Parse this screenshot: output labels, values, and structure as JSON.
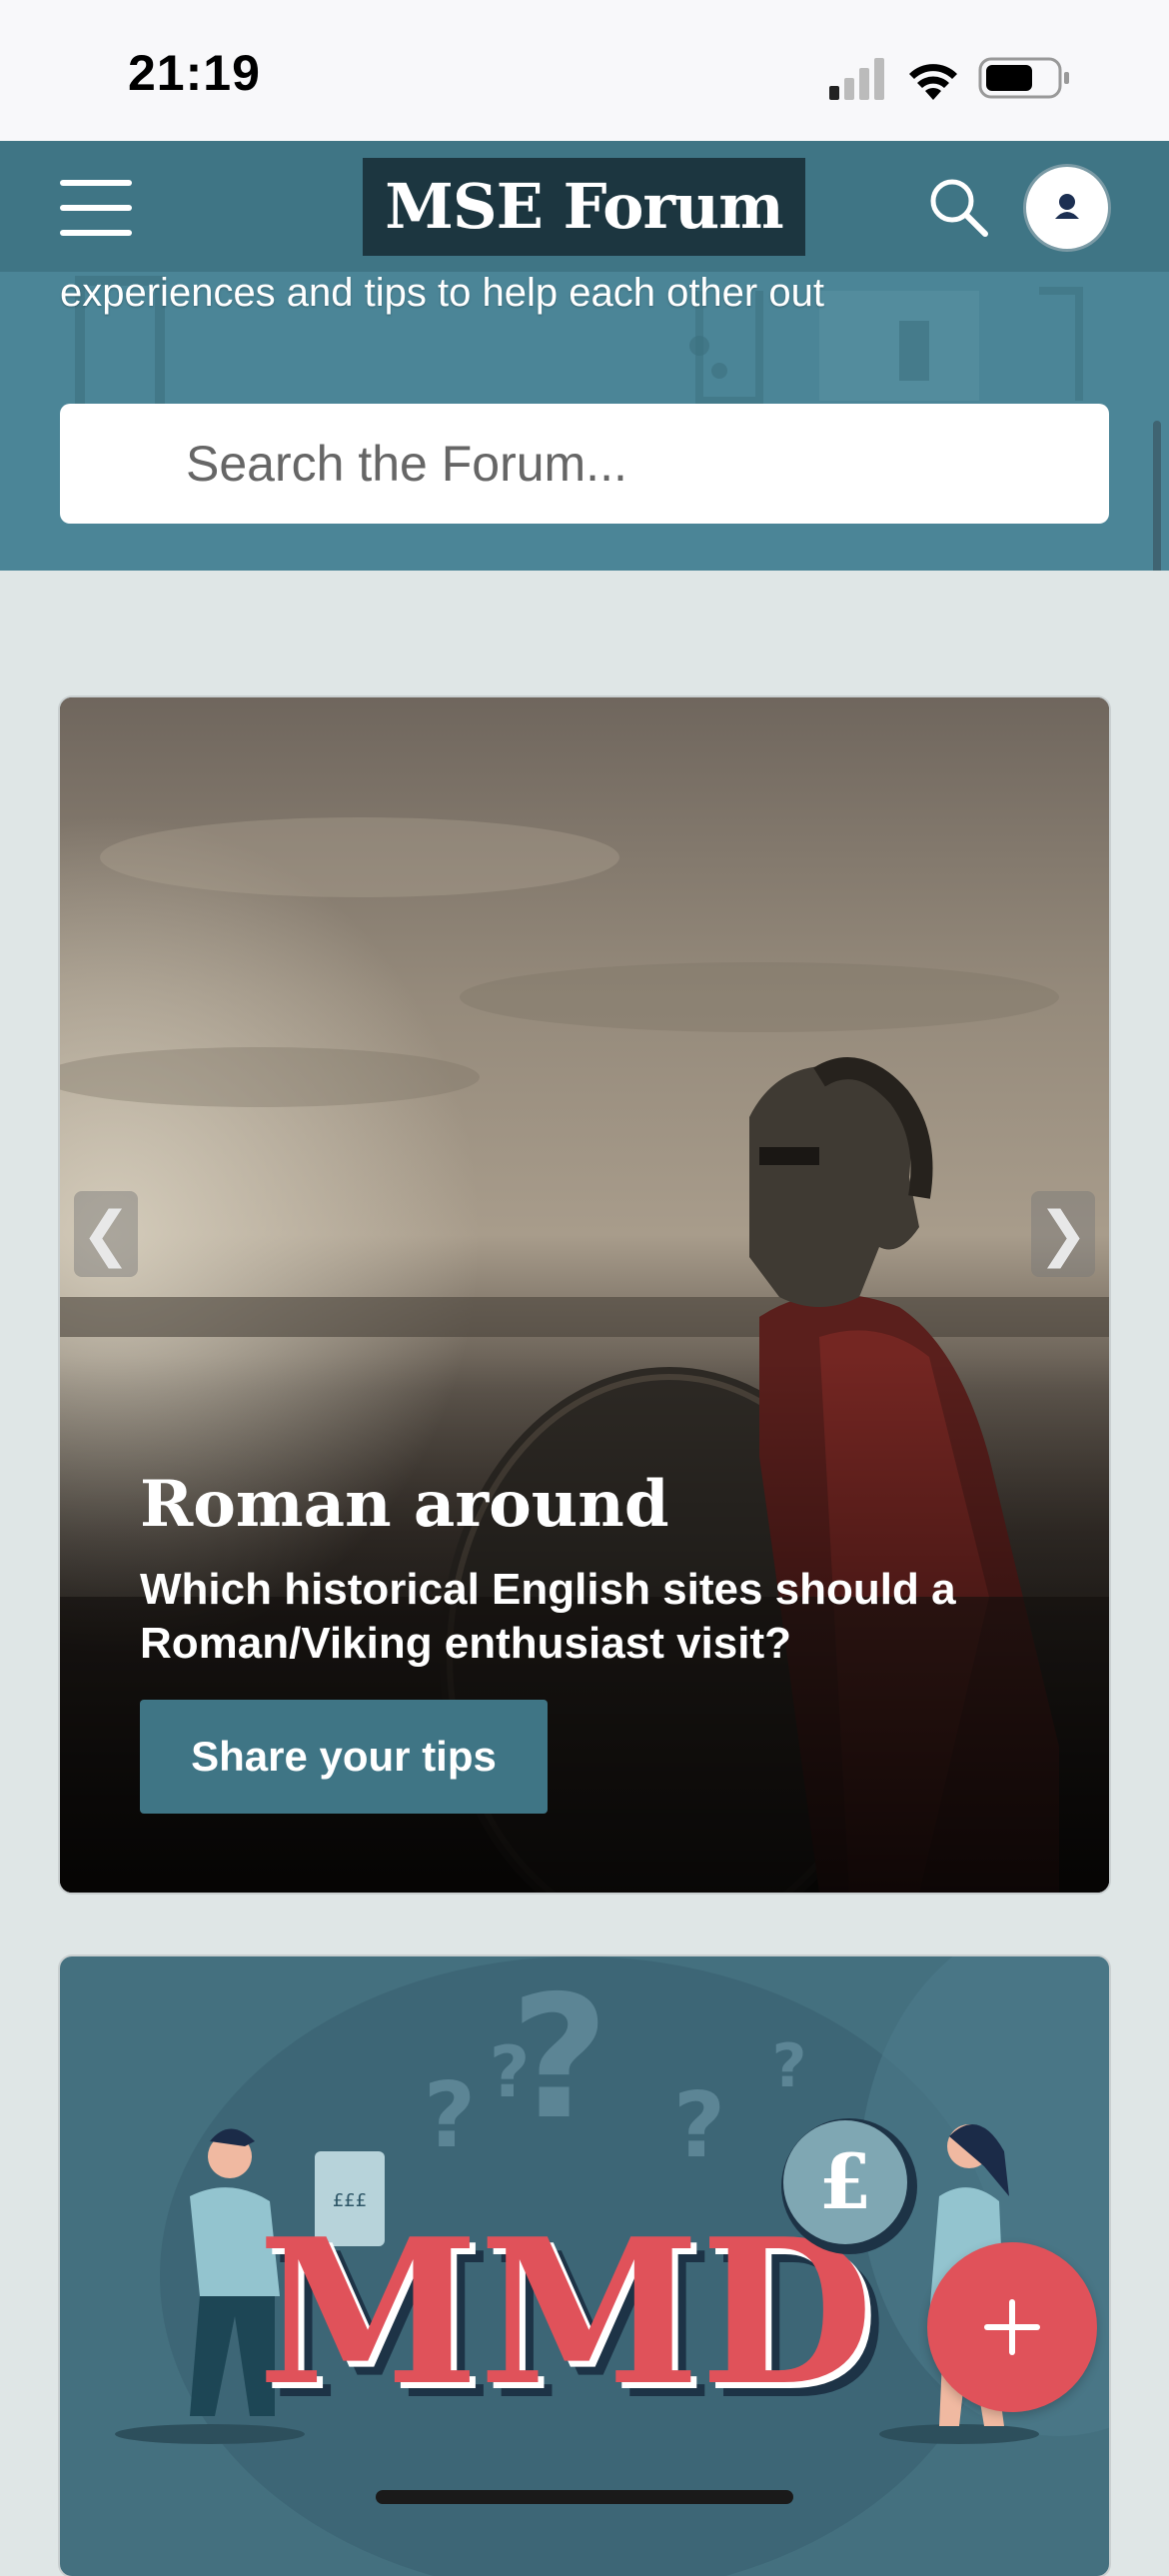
{
  "status_bar": {
    "time": "21:19",
    "icons": [
      "signal-icon",
      "wifi-icon",
      "battery-icon"
    ]
  },
  "header": {
    "logo": "MSE Forum",
    "menu_icon": "hamburger-menu-icon",
    "search_icon": "search-icon",
    "avatar_icon": "user-avatar-icon"
  },
  "hero": {
    "tagline": "experiences and tips to help each other out",
    "search_placeholder": "Search the Forum..."
  },
  "featured": {
    "title": "Roman around",
    "description": "Which historical English sites should a Roman/Viking enthusiast visit?",
    "cta_label": "Share your tips",
    "prev_label": "❮",
    "next_label": "❯"
  },
  "mmd_card": {
    "logo_text": "MMD",
    "receipt_text": "£££",
    "coin_symbol": "£"
  },
  "fab": {
    "icon": "plus-icon"
  },
  "colors": {
    "nav": "#3f7585",
    "hero": "#4b8597",
    "logo_bg": "#1c3640",
    "cta": "#3f7585",
    "fab": "#e0525a",
    "page_bg": "#dfe6e6"
  }
}
